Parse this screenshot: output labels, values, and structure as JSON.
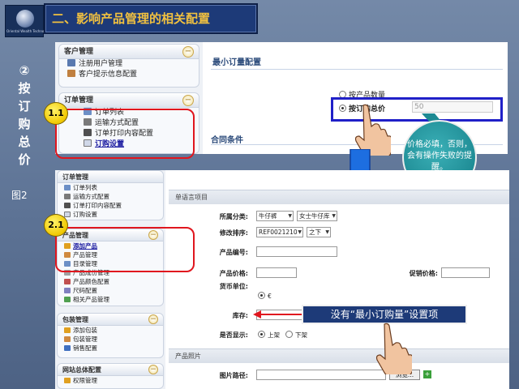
{
  "header": {
    "logo_caption": "Oriental Wealth Technology",
    "title": "二、影响产品管理的相关配置"
  },
  "side": {
    "label": "②\n按\n订\n购\n总\n价",
    "figure": "图2"
  },
  "shot1": {
    "customer": {
      "title": "客户管理",
      "items": [
        "注册用户管理",
        "客户提示信息配置"
      ]
    },
    "orders": {
      "title": "订单管理",
      "items": [
        "订单列表",
        "运输方式配置",
        "订单打印内容配置",
        "订购设置"
      ]
    },
    "min_order_title": "最小订量配置",
    "option_by_qty": "按产品数量",
    "option_by_total": "按订购总价",
    "total_value": "50",
    "contract_title": "合同条件"
  },
  "badges": {
    "b1": "1.1",
    "b2": "2.1"
  },
  "bubble": {
    "text": "价格必填，否则，会有操作失败的提醒。"
  },
  "shot2": {
    "orders": {
      "title": "订单管理",
      "items": [
        "订单列表",
        "运输方式配置",
        "订单打印内容配置",
        "订购设置"
      ]
    },
    "products": {
      "title": "产品管理",
      "items": [
        "添加产品",
        "产品管理",
        "目录管理",
        "产品成份管理",
        "产品颜色配置",
        "尺码配置",
        "相关产品管理"
      ]
    },
    "package": {
      "title": "包装管理",
      "items": [
        "添加包装",
        "包装管理",
        "销售配置"
      ]
    },
    "site": {
      "title": "网站总体配置",
      "items": [
        "权限管理"
      ]
    },
    "form": {
      "section_single": "单语言项目",
      "category_label": "所属分类:",
      "category_1": "牛仔裤",
      "category_2": "女士牛仔库",
      "sort_label": "修改排序:",
      "sort_value": "REF0021210",
      "sort_pos": "之下",
      "code_label": "产品编号:",
      "price_label": "产品价格:",
      "promo_label": "促销价格:",
      "currency_label": "货币单位:",
      "currency_value": "€",
      "stock_label": "库存:",
      "show_label": "是否显示:",
      "show_on": "上架",
      "show_off": "下架",
      "section_photo": "产品照片",
      "image_path_label": "图片路径:",
      "browse": "浏览..."
    }
  },
  "note": {
    "text": "没有“最小订购量”设置项"
  },
  "colors": {
    "highlight_red": "#e0161e",
    "highlight_blue": "#2020c8",
    "title_gold": "#f0c040"
  }
}
